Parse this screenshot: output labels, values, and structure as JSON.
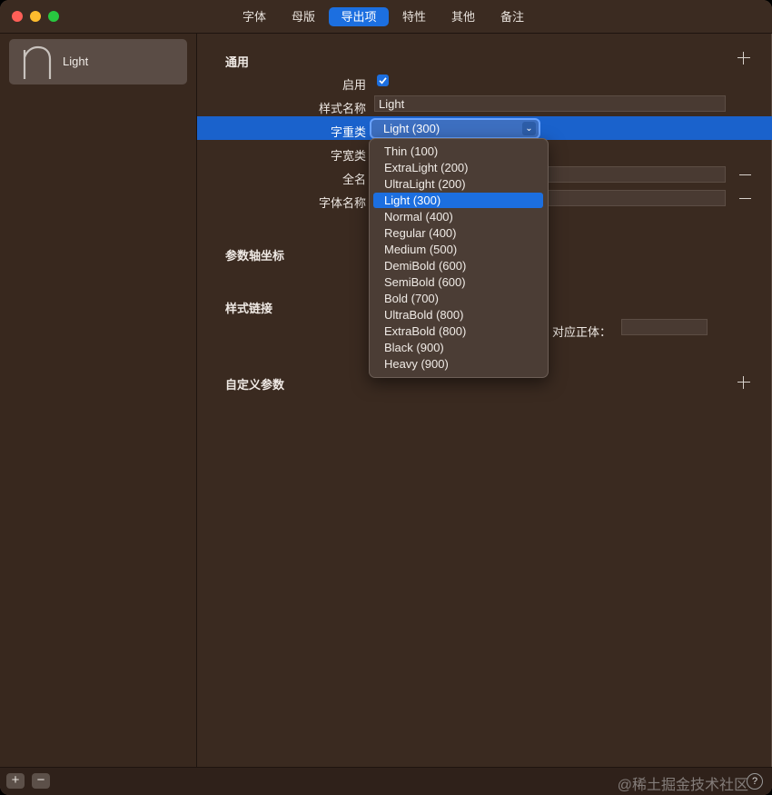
{
  "tabs": [
    "字体",
    "母版",
    "导出项",
    "特性",
    "其他",
    "备注"
  ],
  "active_tab": "导出项",
  "sidebar": {
    "items": [
      {
        "label": "Light",
        "glyph": "n"
      }
    ]
  },
  "sections": {
    "general": "通用",
    "axis_coords": "参数轴坐标",
    "style_linking": "样式链接",
    "custom_params": "自定义参数"
  },
  "fields": {
    "enabled_label": "启用",
    "enabled": true,
    "style_name_label": "样式名称",
    "style_name_value": "Light",
    "weight_label": "字重类",
    "weight_value": "Light (300)",
    "width_label": "字宽类",
    "fullname_label": "全名",
    "fontname_label": "字体名称",
    "regular_counterpart_label": "对应正体："
  },
  "weight_options": [
    "Thin (100)",
    "ExtraLight (200)",
    "UltraLight (200)",
    "Light (300)",
    "Normal (400)",
    "Regular (400)",
    "Medium (500)",
    "DemiBold (600)",
    "SemiBold (600)",
    "Bold (700)",
    "UltraBold (800)",
    "ExtraBold (800)",
    "Black (900)",
    "Heavy (900)"
  ],
  "selected_weight_index": 3,
  "bottom": {
    "add": "+",
    "remove": "−",
    "help": "?"
  },
  "watermark": "@稀土掘金技术社区",
  "colors": {
    "accent": "#1c6fe0",
    "background": "#3a2a20"
  }
}
